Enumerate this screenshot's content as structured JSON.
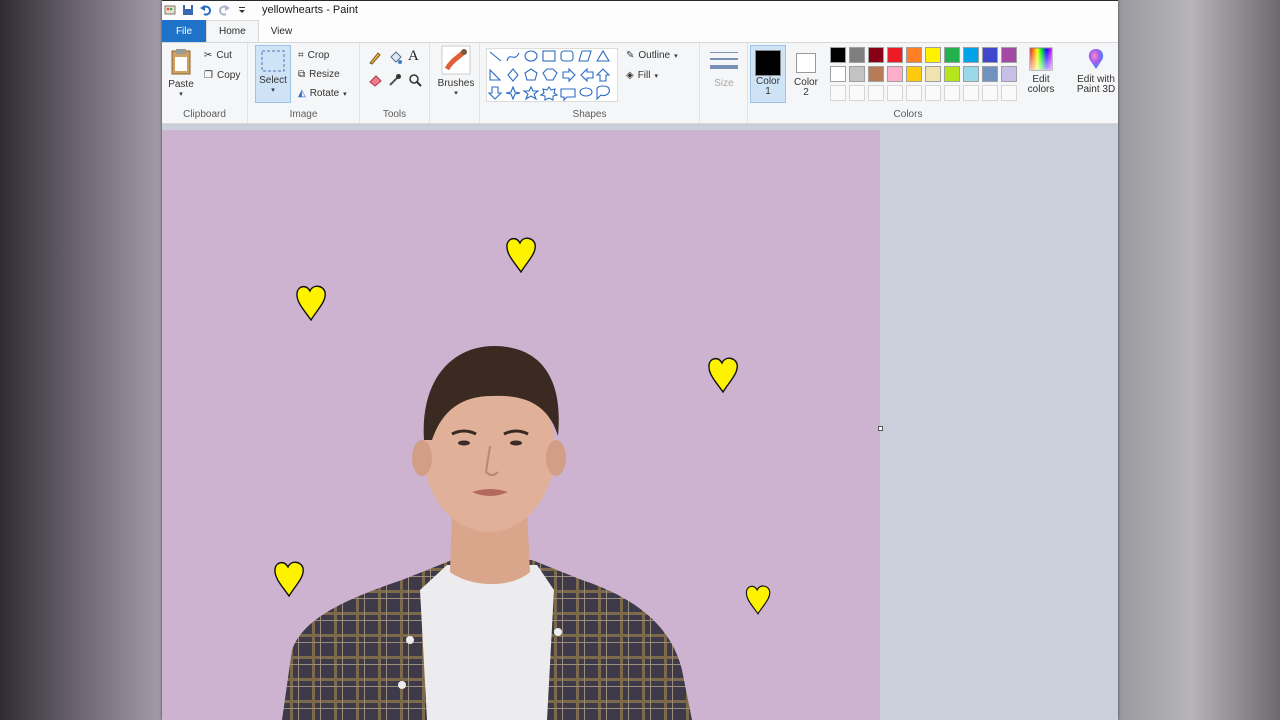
{
  "window": {
    "title": "yellowhearts - Paint"
  },
  "tabs": [
    {
      "label": "File"
    },
    {
      "label": "Home"
    },
    {
      "label": "View"
    }
  ],
  "clipboard": {
    "paste": "Paste",
    "cut": "Cut",
    "copy": "Copy",
    "group": "Clipboard"
  },
  "image": {
    "select": "Select",
    "crop": "Crop",
    "resize": "Resize",
    "rotate": "Rotate",
    "group": "Image"
  },
  "tools": {
    "group": "Tools",
    "text_glyph": "A"
  },
  "brushes": {
    "label": "Brushes"
  },
  "shapes": {
    "outline": "Outline",
    "fill": "Fill",
    "group": "Shapes"
  },
  "size": {
    "label": "Size"
  },
  "colors": {
    "color1": "Color",
    "color1_num": "1",
    "color2": "Color",
    "color2_num": "2",
    "edit": "Edit",
    "edit2": "colors",
    "paint3d": "Edit with",
    "paint3d2": "Paint 3D",
    "group": "Colors",
    "row1": [
      "#000000",
      "#7f7f7f",
      "#880015",
      "#ed1c24",
      "#ff7f27",
      "#fff200",
      "#22b14c",
      "#00a2e8",
      "#3f48cc",
      "#a349a4"
    ],
    "row2": [
      "#ffffff",
      "#c3c3c3",
      "#b97a57",
      "#ffaec9",
      "#ffc90e",
      "#efe4b0",
      "#b5e61d",
      "#99d9ea",
      "#7092be",
      "#c8bfe7"
    ]
  },
  "accent": "#1e73c9",
  "canvas_background": "#cdb3d0",
  "heart_color": "#fff200"
}
